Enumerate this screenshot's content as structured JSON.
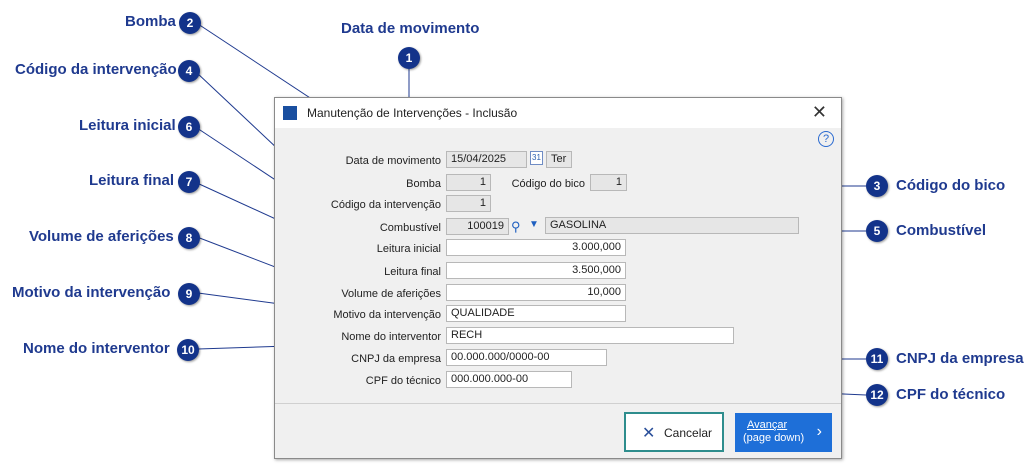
{
  "callouts": [
    {
      "n": "1",
      "label": "Data de movimento"
    },
    {
      "n": "2",
      "label": "Bomba"
    },
    {
      "n": "3",
      "label": "Código do bico"
    },
    {
      "n": "4",
      "label": "Código da intervenção"
    },
    {
      "n": "5",
      "label": "Combustível"
    },
    {
      "n": "6",
      "label": "Leitura inicial"
    },
    {
      "n": "7",
      "label": "Leitura final"
    },
    {
      "n": "8",
      "label": "Volume de aferições"
    },
    {
      "n": "9",
      "label": "Motivo da intervenção"
    },
    {
      "n": "10",
      "label": "Nome do interventor"
    },
    {
      "n": "11",
      "label": "CNPJ da empresa"
    },
    {
      "n": "12",
      "label": "CPF do técnico"
    }
  ],
  "dialog": {
    "title": "Manutenção de Intervenções - Inclusão",
    "close": "✕",
    "help": "?",
    "fields": {
      "data_movimento": {
        "label": "Data de movimento",
        "value": "15/04/2025",
        "weekday": "Ter",
        "calendar": "31"
      },
      "bomba": {
        "label": "Bomba",
        "value": "1"
      },
      "codigo_bico": {
        "label": "Código do bico",
        "value": "1"
      },
      "codigo_intervencao": {
        "label": "Código da intervenção",
        "value": "1"
      },
      "combustivel": {
        "label": "Combustível",
        "code": "100019",
        "name": "GASOLINA"
      },
      "leitura_inicial": {
        "label": "Leitura inicial",
        "value": "3.000,000"
      },
      "leitura_final": {
        "label": "Leitura final",
        "value": "3.500,000"
      },
      "volume_afericoes": {
        "label": "Volume de aferições",
        "value": "10,000"
      },
      "motivo": {
        "label": "Motivo da intervenção",
        "value": "QUALIDADE"
      },
      "nome_interventor": {
        "label": "Nome do interventor",
        "value": "RECH"
      },
      "cnpj": {
        "label": "CNPJ da empresa",
        "value": "00.000.000/0000-00"
      },
      "cpf": {
        "label": "CPF do técnico",
        "value": "000.000.000-00"
      }
    },
    "buttons": {
      "cancel": "Cancelar",
      "next_line1": "Avançar",
      "next_line2": "(page down)"
    }
  },
  "colors": {
    "callout": "#1f3a8f",
    "badge": "#13338a",
    "primary_button": "#1e6fd8"
  }
}
